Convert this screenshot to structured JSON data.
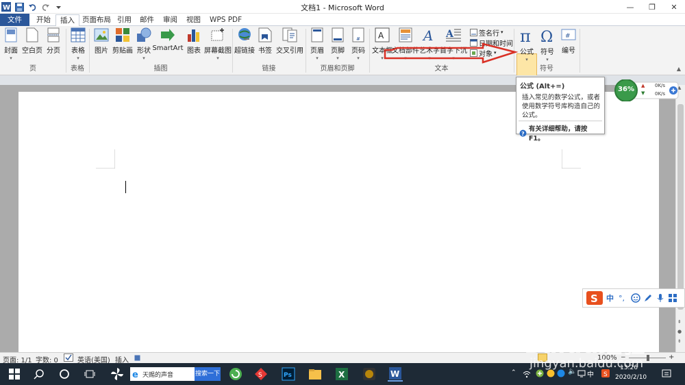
{
  "window": {
    "title": "文档1 - Microsoft Word",
    "min": "—",
    "max": "❐",
    "close": "✕"
  },
  "tabs": [
    "文件",
    "开始",
    "插入",
    "页面布局",
    "引用",
    "邮件",
    "审阅",
    "视图",
    "WPS PDF"
  ],
  "ribbon": {
    "buttons": [
      "封面",
      "空白页",
      "分页",
      "表格",
      "图片",
      "剪贴画",
      "形状",
      "SmartArt",
      "图表",
      "屏幕截图",
      "超链接",
      "书签",
      "交叉引用",
      "页眉",
      "页脚",
      "页码",
      "文本框",
      "文档部件",
      "艺术字",
      "首字下沉",
      "公式",
      "符号",
      "编号"
    ],
    "small": [
      "签名行",
      "日期和时间",
      "对象"
    ],
    "groups": [
      "页",
      "表格",
      "插图",
      "链接",
      "页眉和页脚",
      "文本",
      "符号"
    ]
  },
  "tooltip": {
    "title": "公式 (Alt+=)",
    "body1": "插入常见的数学公式，或者",
    "body2": "使用数学符号库构造自己的",
    "body3": "公式。",
    "help": "有关详细帮助，请按 F1。"
  },
  "speed": {
    "percent": "36%",
    "up": "0K/s",
    "down": "0K/s"
  },
  "sogou": {
    "mode": "中"
  },
  "status": {
    "page": "页面: 1/1",
    "words": "字数: 0",
    "lang": "英语(美国)",
    "mode": "插入",
    "zoom": "100%"
  },
  "taskbar": {
    "search_text": "天赐的声音",
    "search_btn": "搜索一下",
    "ime": "中",
    "time": "13:26",
    "date": "2020/2/10"
  },
  "watermark": {
    "text": "Baidu经验",
    "url": "jingyan.baidu.com"
  },
  "colors": {
    "accent": "#2b579a",
    "taskbar": "#1e2a36",
    "highlight": "#fde6a6"
  }
}
